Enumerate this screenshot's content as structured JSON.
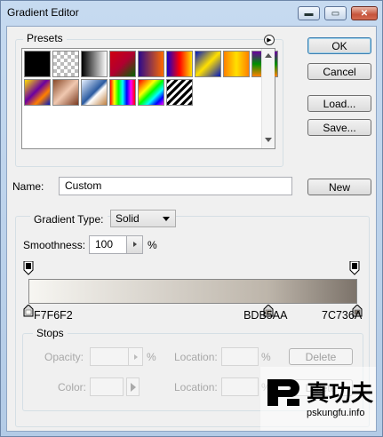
{
  "window": {
    "title": "Gradient Editor",
    "minimize_glyph": "▬",
    "maximize_glyph": "▭",
    "close_glyph": "✕"
  },
  "presets": {
    "legend": "Presets",
    "menu_glyph": "▶",
    "swatches": [
      {
        "name": "black-white",
        "bg": "linear-gradient(90deg,#000,#000)"
      },
      {
        "name": "transparent-checker",
        "bg": "repeating-conic-gradient(#bbb 0% 25%, #fff 0% 50%) 0 0/8px 8px"
      },
      {
        "name": "black-to-white",
        "bg": "linear-gradient(90deg,#000,#fff)"
      },
      {
        "name": "red-green",
        "bg": "linear-gradient(135deg,#d00010,#b00030 50%,#006600)"
      },
      {
        "name": "violet-orange",
        "bg": "linear-gradient(90deg,#2b0a8c,#ff6a00)"
      },
      {
        "name": "blue-red-yellow",
        "bg": "linear-gradient(90deg,#1800c8,#ff0000,#ffe000)"
      },
      {
        "name": "blue-yellow-blue",
        "bg": "linear-gradient(135deg,#0018c0,#ffe000 50%,#0018c0)"
      },
      {
        "name": "orange-yellow-orange",
        "bg": "linear-gradient(90deg,#ff8000,#ffe000,#ff8000)"
      },
      {
        "name": "violet-green-orange",
        "bg": "linear-gradient(180deg,#6a00a0,#009000 50%,#ff8000)"
      },
      {
        "name": "yellow-violet-orange-blue",
        "bg": "linear-gradient(135deg,#ffe000,#6a00a0 45%,#ff8000 70%,#0018c0)"
      },
      {
        "name": "copper",
        "bg": "linear-gradient(135deg,#8a4a2a,#f0c8b0 50%,#7a3a20)"
      },
      {
        "name": "chrome",
        "bg": "linear-gradient(135deg,#e6f0ff,#2a5aa0 50%,#ffffff 60%,#c08040)"
      },
      {
        "name": "spectrum",
        "bg": "linear-gradient(90deg,#ff0000,#ffff00,#00ff00,#00ffff,#0000ff,#ff00ff,#ff0000)"
      },
      {
        "name": "transparent-rainbow",
        "bg": "linear-gradient(135deg,#ff0000,#ff8000,#ffff00,#00ff00,#00ffff,#0000ff,#ff00ff)"
      },
      {
        "name": "transparent-stripes",
        "bg": "repeating-linear-gradient(135deg,#000 0 3px,#fff 3px 6px)"
      }
    ]
  },
  "buttons": {
    "ok": "OK",
    "cancel": "Cancel",
    "load": "Load...",
    "save": "Save...",
    "new": "New"
  },
  "name_field": {
    "label": "Name:",
    "value": "Custom"
  },
  "gradient": {
    "type_label": "Gradient Type:",
    "type_value": "Solid",
    "smoothness_label": "Smoothness:",
    "smoothness_value": "100",
    "smoothness_unit": "%",
    "bar_background": "linear-gradient(90deg,#f7f6f2 0%,#bdb5aa 73%,#7c736a 100%)",
    "color_stops": [
      {
        "hex": "F7F6F2",
        "color": "#f7f6f2",
        "position": 0.0
      },
      {
        "hex": "BDB5AA",
        "color": "#bdb5aa",
        "position": 0.73
      },
      {
        "hex": "7C736A",
        "color": "#7c736a",
        "position": 1.0
      }
    ]
  },
  "stops": {
    "legend": "Stops",
    "opacity_label": "Opacity:",
    "opacity_unit": "%",
    "location_label": "Location:",
    "location_unit": "%",
    "delete_label": "Delete",
    "color_label": "Color:"
  },
  "watermark": {
    "logo_text": "真功夫",
    "url": "pskungfu.info"
  }
}
